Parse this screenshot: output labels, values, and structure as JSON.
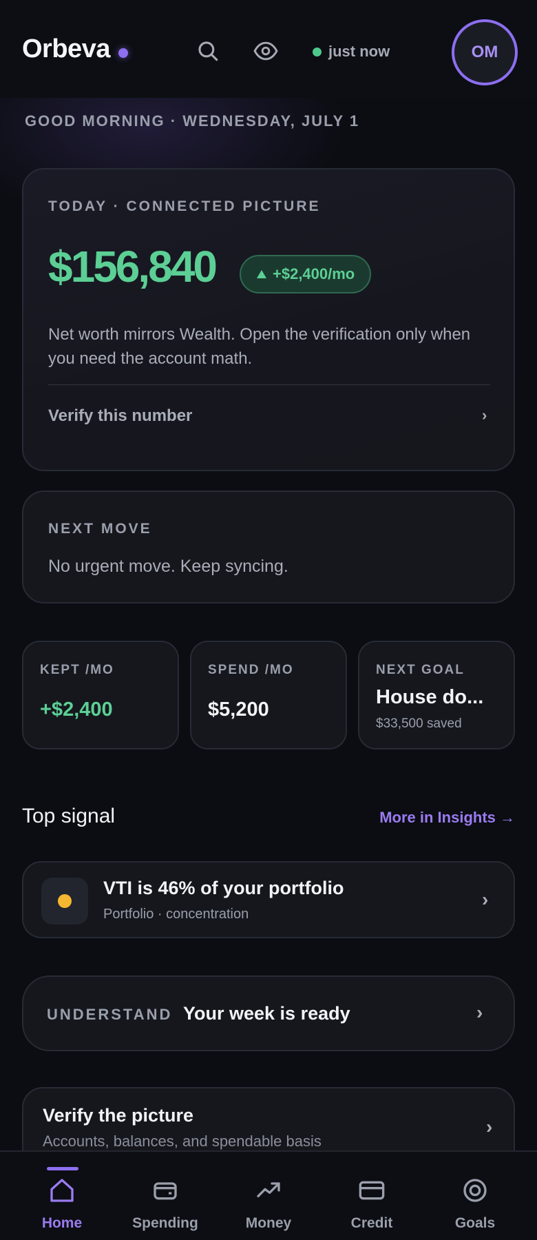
{
  "header": {
    "brand": "Orbeva",
    "sync_status": "just now",
    "avatar_initials": "OM"
  },
  "greeting": "GOOD MORNING · WEDNESDAY, JULY 1",
  "hero": {
    "eyebrow": "TODAY · CONNECTED PICTURE",
    "net_worth": "$156,840",
    "delta": "+$2,400/mo",
    "body": "Net worth mirrors Wealth. Open the verification only when you need the account math.",
    "verify_link": "Verify this number"
  },
  "next_move": {
    "eyebrow": "NEXT MOVE",
    "text": "No urgent move. Keep syncing."
  },
  "stats": {
    "kept": {
      "label": "KEPT /MO",
      "value": "+$2,400"
    },
    "spend": {
      "label": "SPEND /MO",
      "value": "$5,200"
    },
    "goal": {
      "label": "NEXT GOAL",
      "name": "House do...",
      "saved": "$33,500 saved"
    }
  },
  "top_signal": {
    "title": "Top signal",
    "link": "More in Insights →",
    "item_title": "VTI is 46% of your portfolio",
    "item_sub": "Portfolio · concentration"
  },
  "understand": {
    "eyebrow": "UNDERSTAND",
    "title": "Your week is ready"
  },
  "verify_card": {
    "title": "Verify the picture",
    "sub": "Accounts, balances, and spendable basis"
  },
  "tabs": [
    {
      "label": "Home",
      "icon": "home-icon",
      "active": true
    },
    {
      "label": "Spending",
      "icon": "wallet-icon",
      "active": false
    },
    {
      "label": "Money",
      "icon": "trend-up-icon",
      "active": false
    },
    {
      "label": "Credit",
      "icon": "credit-card-icon",
      "active": false
    },
    {
      "label": "Goals",
      "icon": "target-icon",
      "active": false
    }
  ],
  "colors": {
    "accent": "#8d6ff0",
    "positive": "#5ccf95",
    "warning": "#f5b731",
    "background": "#0b0d12"
  }
}
